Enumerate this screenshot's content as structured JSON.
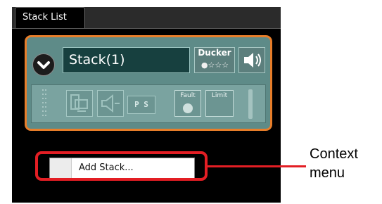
{
  "tab": {
    "label": "Stack List"
  },
  "stack": {
    "name": "Stack(1)",
    "ducker_label": "Ducker",
    "ducker_rating": "●☆☆☆",
    "fault_label": "Fault",
    "limit_label": "Limit",
    "ps_label": "P S"
  },
  "context_menu": {
    "items": [
      "Add Stack..."
    ]
  },
  "callout": {
    "label": "Context\nmenu"
  },
  "colors": {
    "card_border": "#e87e2a",
    "card_fill": "#5e8b88",
    "highlight": "#e31e24"
  },
  "icons": [
    "chevron-down-icon",
    "speaker-icon",
    "monitor-icon",
    "speaker-outline-icon",
    "ps-icon",
    "fault-indicator-icon"
  ]
}
